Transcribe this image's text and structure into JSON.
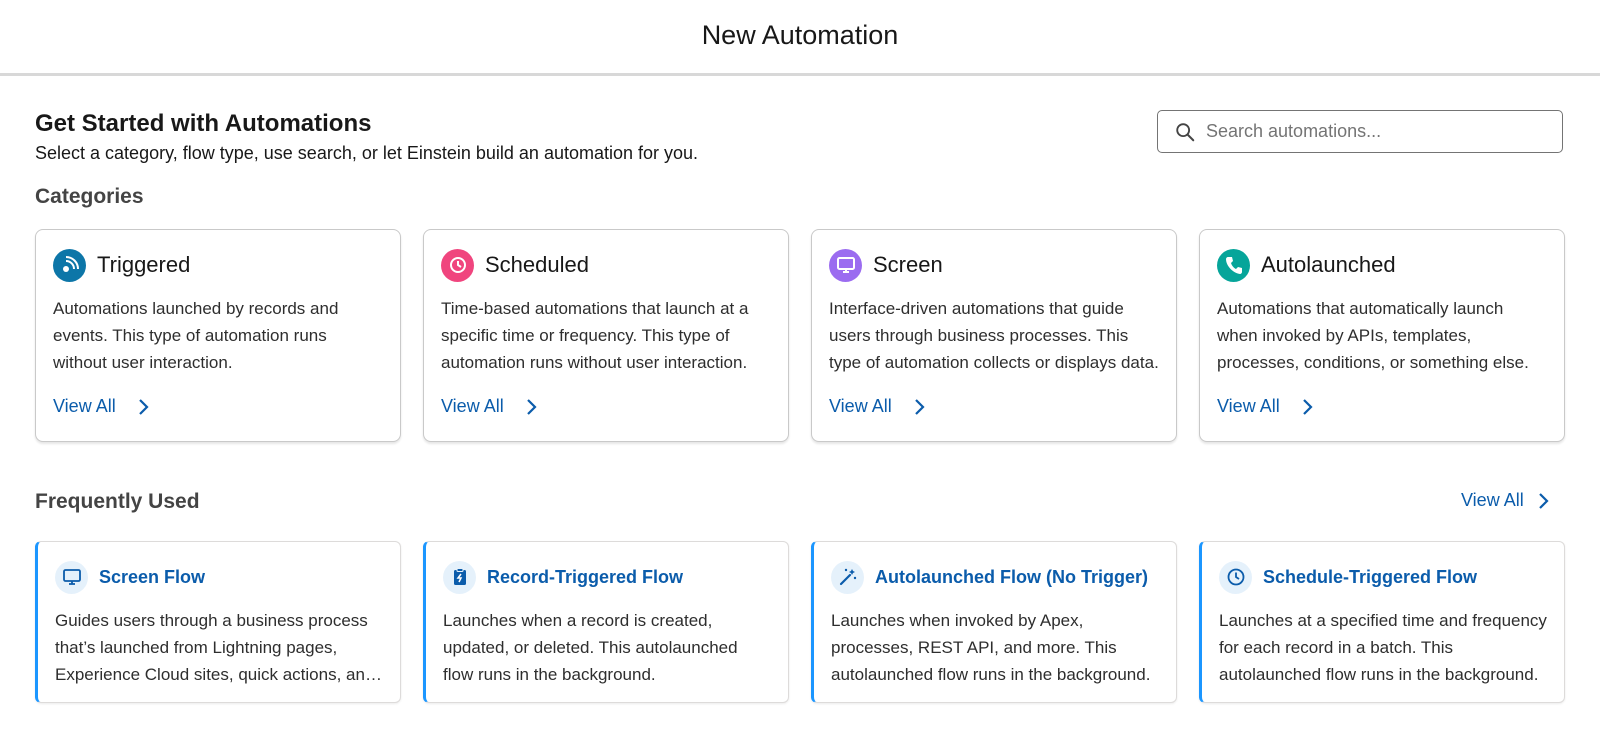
{
  "header": {
    "title": "New Automation"
  },
  "hero": {
    "title": "Get Started with Automations",
    "subtitle": "Select a category, flow type, use search, or let Einstein build an automation for you."
  },
  "search": {
    "placeholder": "Search automations...",
    "icon": "search-icon"
  },
  "categories": {
    "title": "Categories",
    "items": [
      {
        "name": "Triggered",
        "icon": "triggered-icon",
        "color": "#0d76a8",
        "description": "Automations launched by records and events. This type of automation runs without user interaction.",
        "link": "View All"
      },
      {
        "name": "Scheduled",
        "icon": "clock-icon",
        "color": "#f0457e",
        "description": "Time-based automations that launch at a specific time or frequency. This type of automation runs without user interaction.",
        "link": "View All"
      },
      {
        "name": "Screen",
        "icon": "monitor-icon",
        "color": "#9b6cf0",
        "description": "Interface-driven automations that guide users through business processes. This type of automation collects or displays data.",
        "link": "View All"
      },
      {
        "name": "Autolaunched",
        "icon": "phone-icon",
        "color": "#06a59a",
        "description": "Automations that automatically launch when invoked by APIs, templates, processes, conditions, or something else.",
        "link": "View All"
      }
    ]
  },
  "frequently_used": {
    "title": "Frequently Used",
    "view_all": "View All",
    "items": [
      {
        "name": "Screen Flow",
        "icon": "monitor-icon",
        "description": "Guides users through a business process that’s launched from Lightning pages, Experience Cloud sites, quick actions, and more."
      },
      {
        "name": "Record-Triggered Flow",
        "icon": "clipboard-icon",
        "description": "Launches when a record is created, updated, or deleted. This autolaunched flow runs in the background."
      },
      {
        "name": "Autolaunched Flow (No Trigger)",
        "icon": "magic-wand-icon",
        "description": "Launches when invoked by Apex, processes, REST API, and more. This autolaunched flow runs in the background."
      },
      {
        "name": "Schedule-Triggered Flow",
        "icon": "clock-icon",
        "description": "Launches at a specified time and frequency for each record in a batch. This autolaunched flow runs in the background."
      }
    ]
  },
  "colors": {
    "link": "#0b5cab",
    "accent": "#1b96ff",
    "icon_bg": "#e5f1fb"
  }
}
